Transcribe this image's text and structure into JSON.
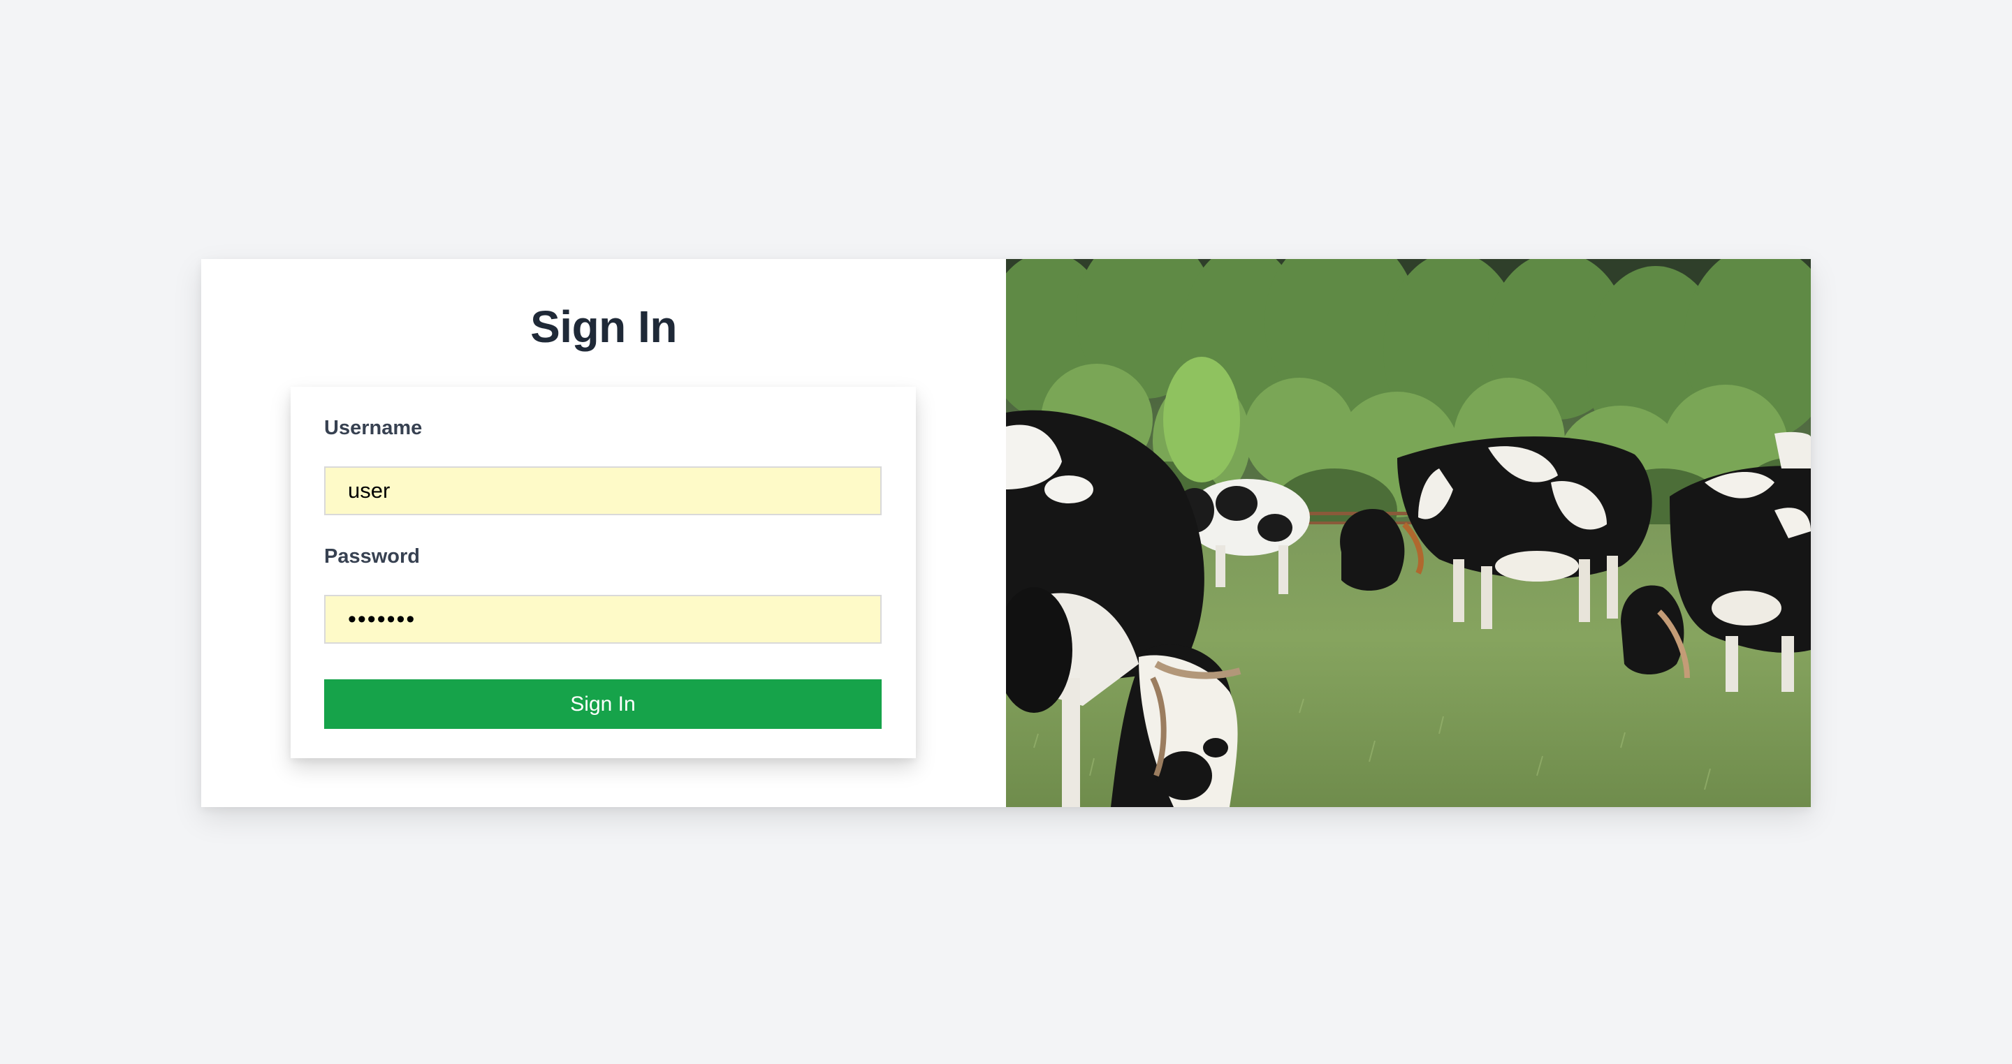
{
  "page": {
    "title": "Sign In"
  },
  "form": {
    "username_label": "Username",
    "username_value": "user",
    "password_label": "Password",
    "password_value": "1234567",
    "submit_label": "Sign In"
  },
  "image": {
    "subject": "cows-grazing-in-pasture"
  },
  "colors": {
    "page_background": "#f3f4f6",
    "input_background": "#fefac8",
    "button": "#16a34a",
    "title_text": "#1f2937"
  }
}
